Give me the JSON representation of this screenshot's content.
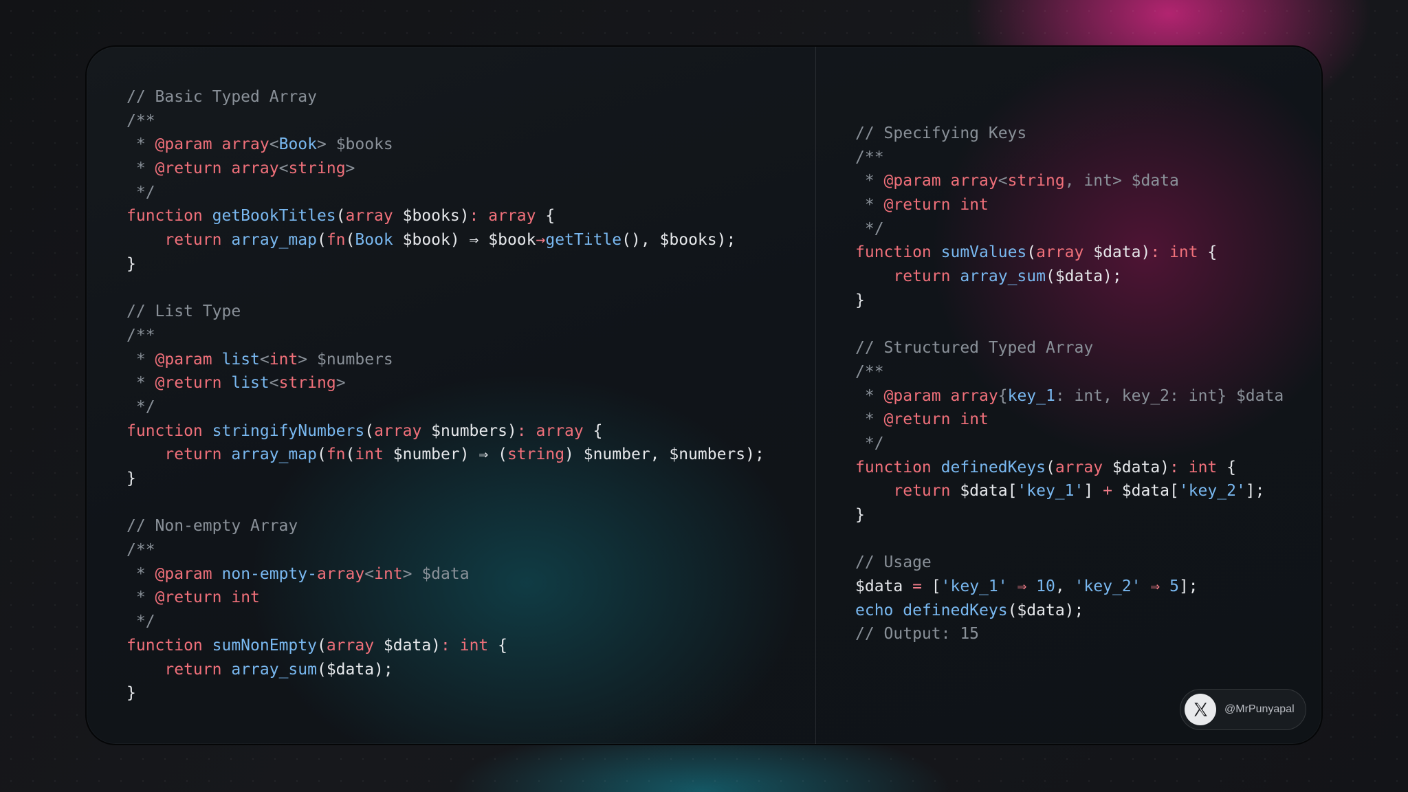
{
  "left_code": [
    [
      [
        "c",
        "// Basic Typed Array"
      ]
    ],
    [
      [
        "c",
        "/**"
      ]
    ],
    [
      [
        "c",
        " * "
      ],
      [
        "k",
        "@param"
      ],
      [
        "n",
        " "
      ],
      [
        "k",
        "array"
      ],
      [
        "c",
        "<"
      ],
      [
        "f",
        "Book"
      ],
      [
        "c",
        "> $books"
      ]
    ],
    [
      [
        "c",
        " * "
      ],
      [
        "k",
        "@return"
      ],
      [
        "n",
        " "
      ],
      [
        "k",
        "array"
      ],
      [
        "c",
        "<"
      ],
      [
        "k",
        "string"
      ],
      [
        "c",
        ">"
      ]
    ],
    [
      [
        "c",
        " */"
      ]
    ],
    [
      [
        "k",
        "function"
      ],
      [
        "n",
        " "
      ],
      [
        "f",
        "getBookTitles"
      ],
      [
        "n",
        "("
      ],
      [
        "k",
        "array"
      ],
      [
        "n",
        " $books)"
      ],
      [
        "p",
        ":"
      ],
      [
        "n",
        " "
      ],
      [
        "k",
        "array"
      ],
      [
        "n",
        " {"
      ]
    ],
    [
      [
        "n",
        "    "
      ],
      [
        "k",
        "return"
      ],
      [
        "n",
        " "
      ],
      [
        "f",
        "array_map"
      ],
      [
        "n",
        "("
      ],
      [
        "k",
        "fn"
      ],
      [
        "n",
        "("
      ],
      [
        "f",
        "Book"
      ],
      [
        "n",
        " $book) ⇒ $book"
      ],
      [
        "p",
        "→"
      ],
      [
        "f",
        "getTitle"
      ],
      [
        "n",
        "(), $books);"
      ]
    ],
    [
      [
        "n",
        "}"
      ]
    ],
    [
      [
        "n",
        ""
      ]
    ],
    [
      [
        "c",
        "// List Type"
      ]
    ],
    [
      [
        "c",
        "/**"
      ]
    ],
    [
      [
        "c",
        " * "
      ],
      [
        "k",
        "@param"
      ],
      [
        "n",
        " "
      ],
      [
        "f",
        "list"
      ],
      [
        "c",
        "<"
      ],
      [
        "k",
        "int"
      ],
      [
        "c",
        "> $numbers"
      ]
    ],
    [
      [
        "c",
        " * "
      ],
      [
        "k",
        "@return"
      ],
      [
        "n",
        " "
      ],
      [
        "f",
        "list"
      ],
      [
        "c",
        "<"
      ],
      [
        "k",
        "string"
      ],
      [
        "c",
        ">"
      ]
    ],
    [
      [
        "c",
        " */"
      ]
    ],
    [
      [
        "k",
        "function"
      ],
      [
        "n",
        " "
      ],
      [
        "f",
        "stringifyNumbers"
      ],
      [
        "n",
        "("
      ],
      [
        "k",
        "array"
      ],
      [
        "n",
        " $numbers)"
      ],
      [
        "p",
        ":"
      ],
      [
        "n",
        " "
      ],
      [
        "k",
        "array"
      ],
      [
        "n",
        " {"
      ]
    ],
    [
      [
        "n",
        "    "
      ],
      [
        "k",
        "return"
      ],
      [
        "n",
        " "
      ],
      [
        "f",
        "array_map"
      ],
      [
        "n",
        "("
      ],
      [
        "k",
        "fn"
      ],
      [
        "n",
        "("
      ],
      [
        "k",
        "int"
      ],
      [
        "n",
        " $number) ⇒ ("
      ],
      [
        "k",
        "string"
      ],
      [
        "n",
        ") $number, $numbers);"
      ]
    ],
    [
      [
        "n",
        "}"
      ]
    ],
    [
      [
        "n",
        ""
      ]
    ],
    [
      [
        "c",
        "// Non-empty Array"
      ]
    ],
    [
      [
        "c",
        "/**"
      ]
    ],
    [
      [
        "c",
        " * "
      ],
      [
        "k",
        "@param"
      ],
      [
        "n",
        " "
      ],
      [
        "f",
        "non-empty-"
      ],
      [
        "k",
        "array"
      ],
      [
        "c",
        "<"
      ],
      [
        "k",
        "int"
      ],
      [
        "c",
        "> $data"
      ]
    ],
    [
      [
        "c",
        " * "
      ],
      [
        "k",
        "@return"
      ],
      [
        "n",
        " "
      ],
      [
        "k",
        "int"
      ]
    ],
    [
      [
        "c",
        " */"
      ]
    ],
    [
      [
        "k",
        "function"
      ],
      [
        "n",
        " "
      ],
      [
        "f",
        "sumNonEmpty"
      ],
      [
        "n",
        "("
      ],
      [
        "k",
        "array"
      ],
      [
        "n",
        " $data)"
      ],
      [
        "p",
        ":"
      ],
      [
        "n",
        " "
      ],
      [
        "k",
        "int"
      ],
      [
        "n",
        " {"
      ]
    ],
    [
      [
        "n",
        "    "
      ],
      [
        "k",
        "return"
      ],
      [
        "n",
        " "
      ],
      [
        "f",
        "array_sum"
      ],
      [
        "n",
        "($data);"
      ]
    ],
    [
      [
        "n",
        "}"
      ]
    ]
  ],
  "right_code": [
    [
      [
        "c",
        "// Specifying Keys"
      ]
    ],
    [
      [
        "c",
        "/**"
      ]
    ],
    [
      [
        "c",
        " * "
      ],
      [
        "k",
        "@param"
      ],
      [
        "n",
        " "
      ],
      [
        "k",
        "array"
      ],
      [
        "c",
        "<"
      ],
      [
        "k",
        "string"
      ],
      [
        "c",
        ", int> $data"
      ]
    ],
    [
      [
        "c",
        " * "
      ],
      [
        "k",
        "@return"
      ],
      [
        "n",
        " "
      ],
      [
        "k",
        "int"
      ]
    ],
    [
      [
        "c",
        " */"
      ]
    ],
    [
      [
        "k",
        "function"
      ],
      [
        "n",
        " "
      ],
      [
        "f",
        "sumValues"
      ],
      [
        "n",
        "("
      ],
      [
        "k",
        "array"
      ],
      [
        "n",
        " $data)"
      ],
      [
        "p",
        ":"
      ],
      [
        "n",
        " "
      ],
      [
        "k",
        "int"
      ],
      [
        "n",
        " {"
      ]
    ],
    [
      [
        "n",
        "    "
      ],
      [
        "k",
        "return"
      ],
      [
        "n",
        " "
      ],
      [
        "f",
        "array_sum"
      ],
      [
        "n",
        "($data);"
      ]
    ],
    [
      [
        "n",
        "}"
      ]
    ],
    [
      [
        "n",
        ""
      ]
    ],
    [
      [
        "c",
        "// Structured Typed Array"
      ]
    ],
    [
      [
        "c",
        "/**"
      ]
    ],
    [
      [
        "c",
        " * "
      ],
      [
        "k",
        "@param"
      ],
      [
        "n",
        " "
      ],
      [
        "k",
        "array"
      ],
      [
        "c",
        "{"
      ],
      [
        "f",
        "key_1"
      ],
      [
        "c",
        ": int, key_2: int} $data"
      ]
    ],
    [
      [
        "c",
        " * "
      ],
      [
        "k",
        "@return"
      ],
      [
        "n",
        " "
      ],
      [
        "k",
        "int"
      ]
    ],
    [
      [
        "c",
        " */"
      ]
    ],
    [
      [
        "k",
        "function"
      ],
      [
        "n",
        " "
      ],
      [
        "f",
        "definedKeys"
      ],
      [
        "n",
        "("
      ],
      [
        "k",
        "array"
      ],
      [
        "n",
        " $data)"
      ],
      [
        "p",
        ":"
      ],
      [
        "n",
        " "
      ],
      [
        "k",
        "int"
      ],
      [
        "n",
        " {"
      ]
    ],
    [
      [
        "n",
        "    "
      ],
      [
        "k",
        "return"
      ],
      [
        "n",
        " $data["
      ],
      [
        "s",
        "'key_1'"
      ],
      [
        "n",
        "] "
      ],
      [
        "p",
        "+"
      ],
      [
        "n",
        " $data["
      ],
      [
        "s",
        "'key_2'"
      ],
      [
        "n",
        "];"
      ]
    ],
    [
      [
        "n",
        "}"
      ]
    ],
    [
      [
        "n",
        ""
      ]
    ],
    [
      [
        "c",
        "// Usage"
      ]
    ],
    [
      [
        "n",
        "$data "
      ],
      [
        "p",
        "="
      ],
      [
        "n",
        " ["
      ],
      [
        "s",
        "'key_1'"
      ],
      [
        "n",
        " "
      ],
      [
        "p",
        "⇒"
      ],
      [
        "n",
        " "
      ],
      [
        "num",
        "10"
      ],
      [
        "n",
        ", "
      ],
      [
        "s",
        "'key_2'"
      ],
      [
        "n",
        " "
      ],
      [
        "p",
        "⇒"
      ],
      [
        "n",
        " "
      ],
      [
        "num",
        "5"
      ],
      [
        "n",
        "];"
      ]
    ],
    [
      [
        "f",
        "echo"
      ],
      [
        "n",
        " "
      ],
      [
        "f",
        "definedKeys"
      ],
      [
        "n",
        "($data);"
      ]
    ],
    [
      [
        "c",
        "// Output: 15"
      ]
    ]
  ],
  "badge": {
    "icon": "x-logo-icon",
    "handle": "@MrPunyapal"
  },
  "colors": {
    "comment": "#8a9199",
    "keyword": "#f0707a",
    "function": "#79b8f0",
    "text": "#e6e8eb"
  }
}
